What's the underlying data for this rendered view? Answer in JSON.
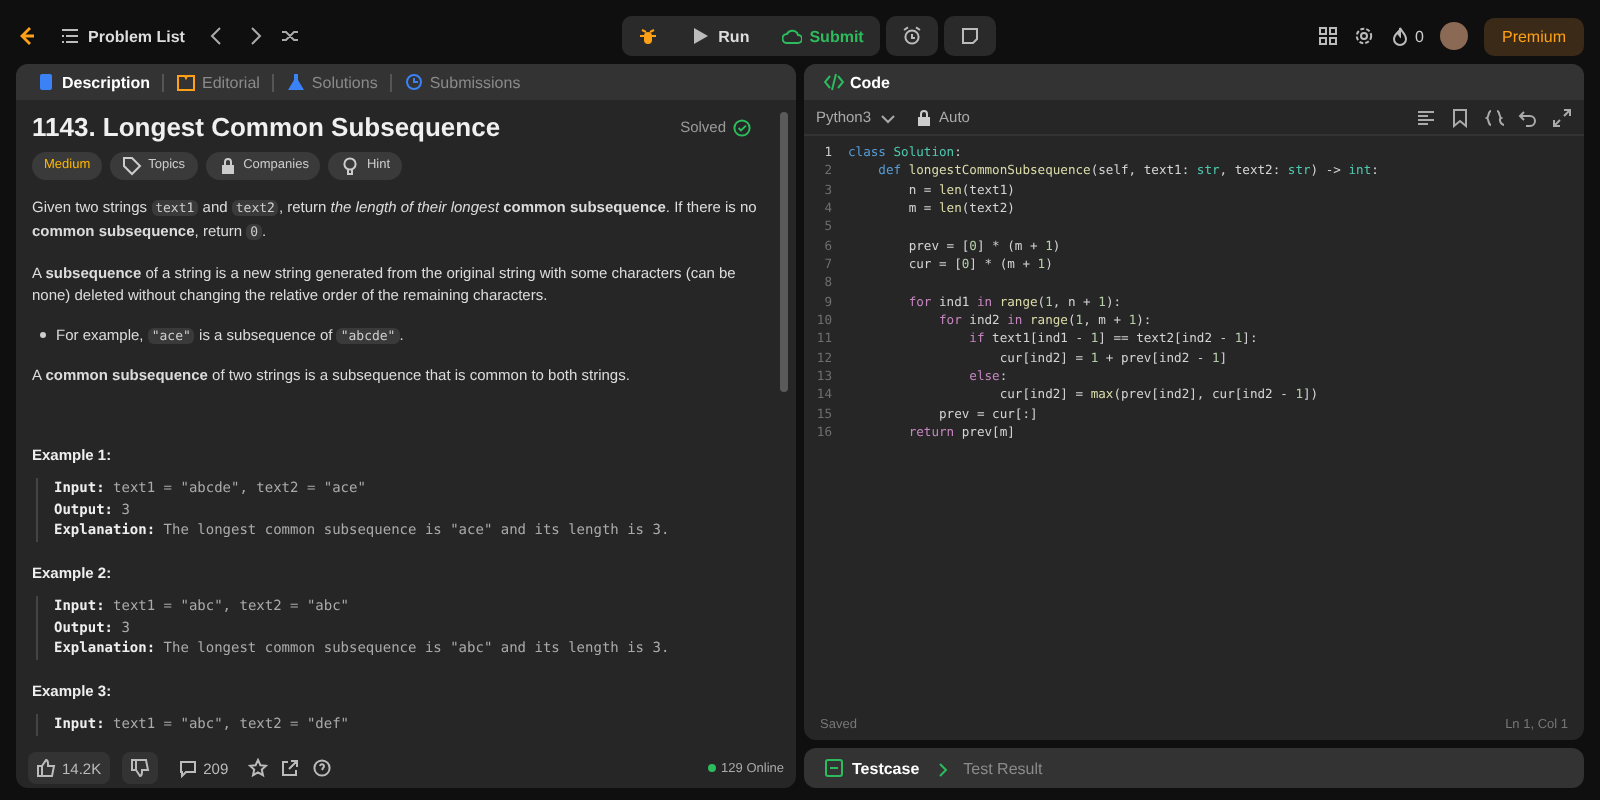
{
  "topbar": {
    "problem_list": "Problem List",
    "run": "Run",
    "submit": "Submit",
    "streak": "0",
    "premium": "Premium"
  },
  "description_tabs": [
    {
      "label": "Description",
      "selected": true
    },
    {
      "label": "Editorial",
      "selected": false
    },
    {
      "label": "Solutions",
      "selected": false
    },
    {
      "label": "Submissions",
      "selected": false
    }
  ],
  "problem": {
    "title": "1143. Longest Common Subsequence",
    "status": "Solved",
    "solved": true,
    "tags": [
      {
        "label": "Medium",
        "kind": "difficulty"
      },
      {
        "label": "Topics",
        "kind": "tag"
      },
      {
        "label": "Companies",
        "kind": "lock"
      },
      {
        "label": "Hint",
        "kind": "bulb"
      }
    ],
    "paragraphs": [
      {
        "kind": "para",
        "parts": [
          {
            "kind": "text",
            "text": "Given two strings "
          },
          {
            "kind": "code",
            "text": "text1"
          },
          {
            "kind": "text",
            "text": " and "
          },
          {
            "kind": "code",
            "text": "text2"
          },
          {
            "kind": "text",
            "text": ", return *the length of their longest* **common subsequence**. If there is no **common subsequence**, return "
          },
          {
            "kind": "code",
            "text": "0"
          },
          {
            "kind": "text",
            "text": "."
          }
        ]
      },
      {
        "kind": "para",
        "parts": [
          {
            "kind": "text",
            "text": "A **subsequence** of a string is a new string generated from the original string with some characters (can be none) deleted without changing the relative order of the remaining characters."
          }
        ]
      },
      {
        "kind": "bullet",
        "parts": [
          {
            "kind": "text",
            "text": "For example, "
          },
          {
            "kind": "code",
            "text": "\"ace\""
          },
          {
            "kind": "text",
            "text": " is a subsequence of "
          },
          {
            "kind": "code",
            "text": "\"abcde\""
          },
          {
            "kind": "text",
            "text": "."
          }
        ]
      },
      {
        "kind": "para",
        "parts": [
          {
            "kind": "text",
            "text": "A **common subsequence** of two strings is a subsequence that is common to both strings."
          }
        ]
      }
    ],
    "examples": [
      {
        "title": "Example 1:",
        "lines": [
          {
            "label": "Input:",
            "value": "text1 = \"abcde\", text2 = \"ace\""
          },
          {
            "label": "Output:",
            "value": "3"
          },
          {
            "label": "Explanation:",
            "value": "The longest common subsequence is \"ace\" and its length is 3."
          }
        ]
      },
      {
        "title": "Example 2:",
        "lines": [
          {
            "label": "Input:",
            "value": "text1 = \"abc\", text2 = \"abc\""
          },
          {
            "label": "Output:",
            "value": "3"
          },
          {
            "label": "Explanation:",
            "value": "The longest common subsequence is \"abc\" and its length is 3."
          }
        ]
      },
      {
        "title": "Example 3:",
        "lines": [
          {
            "label": "Input:",
            "value": "text1 = \"abc\", text2 = \"def\""
          }
        ]
      }
    ]
  },
  "footer": {
    "likes": "14.2K",
    "comments": "209",
    "online": "129 Online"
  },
  "editor": {
    "title": "Code",
    "language": "Python3",
    "mode": "Auto",
    "saved": "Saved",
    "position": "Ln 1, Col 1",
    "lines": [
      {
        "num": "1",
        "current": true,
        "tokens": [
          {
            "kind": "kw",
            "text": "class "
          },
          {
            "kind": "ty",
            "text": "Solution"
          },
          {
            "kind": "p",
            "text": ":"
          }
        ]
      },
      {
        "num": "2",
        "current": false,
        "tokens": [
          {
            "kind": "kw",
            "text": "    def "
          },
          {
            "kind": "fn",
            "text": "longestCommonSubsequence"
          },
          {
            "kind": "p",
            "text": "(self, text1: "
          },
          {
            "kind": "ty",
            "text": "str"
          },
          {
            "kind": "p",
            "text": ", text2: "
          },
          {
            "kind": "ty",
            "text": "str"
          },
          {
            "kind": "p",
            "text": ") -> "
          },
          {
            "kind": "ty",
            "text": "int"
          },
          {
            "kind": "p",
            "text": ":"
          }
        ]
      },
      {
        "num": "3",
        "current": false,
        "tokens": [
          {
            "kind": "p",
            "text": "        n = "
          },
          {
            "kind": "fn",
            "text": "len"
          },
          {
            "kind": "p",
            "text": "(text1)"
          }
        ]
      },
      {
        "num": "4",
        "current": false,
        "tokens": [
          {
            "kind": "p",
            "text": "        m = "
          },
          {
            "kind": "fn",
            "text": "len"
          },
          {
            "kind": "p",
            "text": "(text2)"
          }
        ]
      },
      {
        "num": "5",
        "current": false
      },
      {
        "num": "6",
        "current": false,
        "tokens": [
          {
            "kind": "p",
            "text": "        prev = ["
          },
          {
            "kind": "num",
            "text": "0"
          },
          {
            "kind": "p",
            "text": "] * (m + "
          },
          {
            "kind": "num",
            "text": "1"
          },
          {
            "kind": "p",
            "text": ")"
          }
        ]
      },
      {
        "num": "7",
        "current": false,
        "tokens": [
          {
            "kind": "p",
            "text": "        cur = ["
          },
          {
            "kind": "num",
            "text": "0"
          },
          {
            "kind": "p",
            "text": "] * (m + "
          },
          {
            "kind": "num",
            "text": "1"
          },
          {
            "kind": "p",
            "text": ")"
          }
        ]
      },
      {
        "num": "8",
        "current": false
      },
      {
        "num": "9",
        "current": false,
        "tokens": [
          {
            "kind": "ctl",
            "text": "        for"
          },
          {
            "kind": "p",
            "text": " ind1 "
          },
          {
            "kind": "ctl",
            "text": "in "
          },
          {
            "kind": "fn",
            "text": "range"
          },
          {
            "kind": "p",
            "text": "("
          },
          {
            "kind": "num",
            "text": "1"
          },
          {
            "kind": "p",
            "text": ", n + "
          },
          {
            "kind": "num",
            "text": "1"
          },
          {
            "kind": "p",
            "text": "):"
          }
        ]
      },
      {
        "num": "10",
        "current": false,
        "tokens": [
          {
            "kind": "ctl",
            "text": "            for"
          },
          {
            "kind": "p",
            "text": " ind2 "
          },
          {
            "kind": "ctl",
            "text": "in "
          },
          {
            "kind": "fn",
            "text": "range"
          },
          {
            "kind": "p",
            "text": "("
          },
          {
            "kind": "num",
            "text": "1"
          },
          {
            "kind": "p",
            "text": ", m + "
          },
          {
            "kind": "num",
            "text": "1"
          },
          {
            "kind": "p",
            "text": "):"
          }
        ]
      },
      {
        "num": "11",
        "current": false,
        "tokens": [
          {
            "kind": "ctl",
            "text": "                if"
          },
          {
            "kind": "p",
            "text": " text1[ind1 - "
          },
          {
            "kind": "num",
            "text": "1"
          },
          {
            "kind": "p",
            "text": "] == text2[ind2 - "
          },
          {
            "kind": "num",
            "text": "1"
          },
          {
            "kind": "p",
            "text": "]:"
          }
        ]
      },
      {
        "num": "12",
        "current": false,
        "tokens": [
          {
            "kind": "p",
            "text": "                    cur[ind2] = "
          },
          {
            "kind": "num",
            "text": "1"
          },
          {
            "kind": "p",
            "text": " + prev[ind2 - "
          },
          {
            "kind": "num",
            "text": "1"
          },
          {
            "kind": "p",
            "text": "]"
          }
        ]
      },
      {
        "num": "13",
        "current": false,
        "tokens": [
          {
            "kind": "ctl",
            "text": "                else"
          },
          {
            "kind": "p",
            "text": ":"
          }
        ]
      },
      {
        "num": "14",
        "current": false,
        "tokens": [
          {
            "kind": "p",
            "text": "                    cur[ind2] = "
          },
          {
            "kind": "fn",
            "text": "max"
          },
          {
            "kind": "p",
            "text": "(prev[ind2], cur[ind2 - "
          },
          {
            "kind": "num",
            "text": "1"
          },
          {
            "kind": "p",
            "text": "])"
          }
        ]
      },
      {
        "num": "15",
        "current": false,
        "tokens": [
          {
            "kind": "p",
            "text": "            prev = cur[:]"
          }
        ]
      },
      {
        "num": "16",
        "current": false,
        "tokens": [
          {
            "kind": "ctl",
            "text": "        return"
          },
          {
            "kind": "p",
            "text": " prev[m]"
          }
        ]
      }
    ]
  },
  "console_tabs": [
    {
      "label": "Testcase",
      "selected": true
    },
    {
      "label": "Test Result",
      "selected": false
    }
  ]
}
